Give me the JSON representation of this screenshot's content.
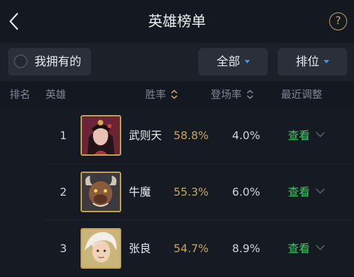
{
  "header": {
    "title": "英雄榜单",
    "back_icon": "back-chevron-icon",
    "help_icon": "help-circle-icon",
    "help_glyph": "?"
  },
  "filters": {
    "owned_label": "我拥有的",
    "all_label": "全部",
    "rank_label": "排位"
  },
  "columns": {
    "rank": "排名",
    "hero": "英雄",
    "winrate": "胜率",
    "pickrate": "登场率",
    "recent": "最近调整"
  },
  "heroes": [
    {
      "rank": "1",
      "name": "武则天",
      "winrate": "58.8%",
      "pickrate": "4.0%",
      "view": "查看",
      "avatar": "hero-avatar-wuzetian"
    },
    {
      "rank": "2",
      "name": "牛魔",
      "winrate": "55.3%",
      "pickrate": "6.0%",
      "view": "查看",
      "avatar": "hero-avatar-niumo"
    },
    {
      "rank": "3",
      "name": "张良",
      "winrate": "54.7%",
      "pickrate": "8.9%",
      "view": "查看",
      "avatar": "hero-avatar-zhangliang"
    }
  ],
  "colors": {
    "accent_gold": "#c8a45d",
    "link_green": "#46c46b",
    "dropdown_blue": "#4a8ff0",
    "background": "#141820"
  }
}
